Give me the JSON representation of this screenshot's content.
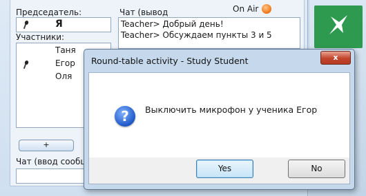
{
  "main": {
    "chairman_label": "Председатель:",
    "chairman_value": "Я",
    "participants_label": "Участники:",
    "participants": [
      "Таня",
      "Егор",
      "Оля"
    ],
    "chat_output_label": "Чат (вывод",
    "chat_lines": [
      "Teacher> Добрый день!",
      "Teacher> Обсуждаем пункты 3 и 5"
    ],
    "on_air_label": "On Air",
    "add_button_label": "+",
    "chat_input_label": "Чат (ввод сообщения)"
  },
  "colors": {
    "on_air": "#f07a1a",
    "tile": "#2e9a4f",
    "close": "#c3442c"
  },
  "dialog": {
    "title": "Round-table activity - Study Student",
    "close_label": "x",
    "message": "Выключить микрофон у ученика Егор",
    "yes_label": "Yes",
    "no_label": "No",
    "icon": "question-icon"
  }
}
